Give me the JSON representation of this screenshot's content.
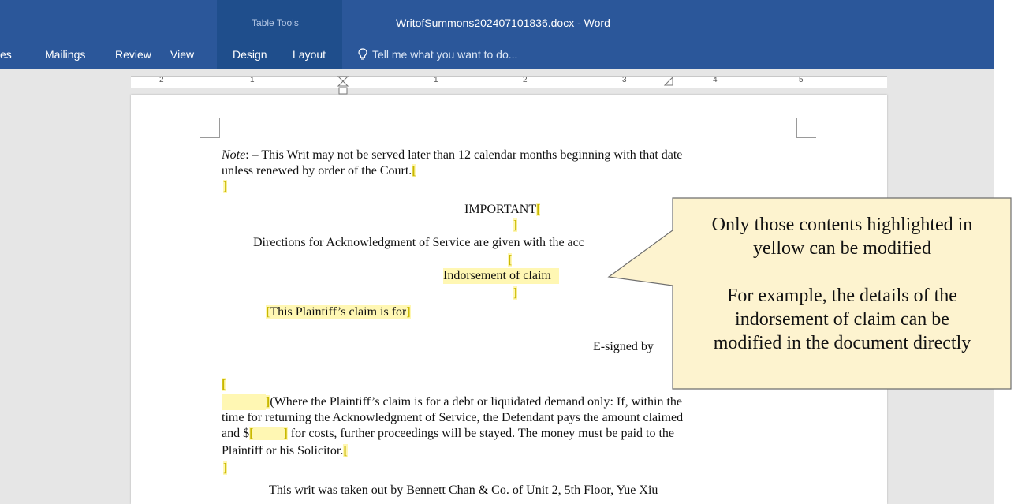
{
  "window": {
    "title": "WritofSummons202407101836.docx - Word",
    "table_tools_label": "Table Tools"
  },
  "ribbon": {
    "tabs": [
      "es",
      "Mailings",
      "Review",
      "View",
      "Design",
      "Layout"
    ],
    "tell_me": "Tell me what you want to do..."
  },
  "ruler": {
    "numbers": [
      "2",
      "1",
      "1",
      "2",
      "3",
      "4",
      "5"
    ]
  },
  "document": {
    "note_label": "Note",
    "note_line1_rest": ": – This Writ may not be served later than 12 calendar months beginning with that date",
    "note_line2": "unless renewed by order of the Court.",
    "important": "IMPORTANT",
    "directions": "Directions for Acknowledgment of Service are given with the acc",
    "indorsement": "Indorsement of claim",
    "plaintiff_claim": "This Plaintiff’s claim is for",
    "esigned": "E-signed by",
    "where_line1": "(Where the Plaintiff’s claim is for a debt or liquidated demand only: If, within the",
    "where_line2": "time for returning the Acknowledgment of Service, the Defendant pays the amount claimed",
    "where_line3_a": "and $",
    "where_line3_b": " for costs, further proceedings will be stayed. The money must be paid to the",
    "where_line4": "Plaintiff or his Solicitor.",
    "writ_line1": "This writ was taken out by Bennett Chan & Co. of Unit 2, 5th Floor, Yue Xiu"
  },
  "callout": {
    "line1": "Only those contents highlighted in",
    "line2": "yellow can be modified",
    "line3": "For example, the details of the",
    "line4": "indorsement of claim can be",
    "line5": "modified in the document directly"
  },
  "colors": {
    "ribbon": "#2b579a",
    "highlight": "#fff7b3",
    "callout_fill": "#fdf3cf",
    "callout_border": "#6e6e6e"
  }
}
